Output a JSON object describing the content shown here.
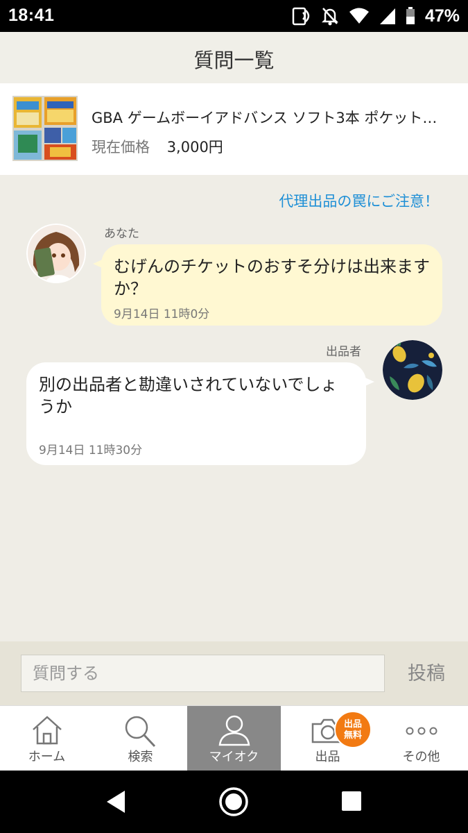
{
  "status_bar": {
    "time": "18:41",
    "battery_percent": "47%"
  },
  "header": {
    "title": "質問一覧"
  },
  "product": {
    "name": "GBA ゲームボーイアドバンス ソフト3本 ポケット…",
    "price_label": "現在価格",
    "price_value": "3,000円"
  },
  "chat": {
    "warning_link": "代理出品の罠にご注意！",
    "messages": [
      {
        "sender": "あなた",
        "text": "むげんのチケットのおすそ分けは出来ますか？",
        "time": "9月14日 11時0分"
      },
      {
        "sender": "出品者",
        "text": "別の出品者と勘違いされていないでしょうか",
        "time": "9月14日 11時30分"
      }
    ]
  },
  "input_bar": {
    "placeholder": "質問する",
    "post_label": "投稿"
  },
  "tabs": [
    {
      "label": "ホーム",
      "icon": "home-icon"
    },
    {
      "label": "検索",
      "icon": "search-icon"
    },
    {
      "label": "マイオク",
      "icon": "person-icon",
      "active": true
    },
    {
      "label": "出品",
      "icon": "camera-icon"
    },
    {
      "label": "その他",
      "icon": "more-icon"
    }
  ],
  "badge": {
    "line1": "出品",
    "line2": "無料"
  },
  "colors": {
    "accent_link": "#1e8fd6",
    "my_bubble": "#fff8d2",
    "badge": "#f27a12",
    "active_tab": "#888888"
  }
}
